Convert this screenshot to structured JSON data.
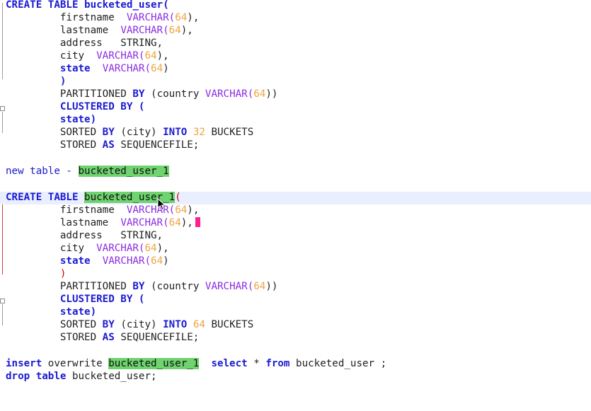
{
  "editor": {
    "block1": {
      "l1": "CREATE TABLE bucketed_user(",
      "l2": "firstname",
      "l3": "lastname",
      "l4": "address",
      "l5": "city",
      "l6": "state",
      "l7": ")",
      "l8_a": "PARTITIONED",
      "l8_b": "BY",
      "l8_c": "(country",
      "l9": "CLUSTERED BY (",
      "l10": "state)",
      "l11_a": "SORTED",
      "l11_b": "BY",
      "l11_c": "(city)",
      "l11_d": "INTO",
      "l11_e": "32",
      "l11_f": "BUCKETS",
      "l12_a": "STORED",
      "l12_b": "AS",
      "l12_c": "SEQUENCEFILE;"
    },
    "type_varchar": "VARCHAR(",
    "type_string": "STRING,",
    "num_64": "64",
    "close_comma": "),",
    "close_paren": ")",
    "close_paren2": "))",
    "new_table_label": "new table - ",
    "new_table_name": "bucketed_user_1",
    "block2": {
      "create": "CREATE TABLE ",
      "name": "bucketed_user_1",
      "open": "(",
      "num_buckets": "64"
    },
    "insert_line": {
      "insert": "insert",
      "overwrite": " overwrite ",
      "table": "bucketed_user_1",
      "select": "select",
      "star": " * ",
      "from": "from",
      "rest": " bucketed_user ;"
    },
    "drop_line": {
      "drop": "drop",
      "table_kw": "table",
      "rest": " bucketed_user;"
    }
  }
}
